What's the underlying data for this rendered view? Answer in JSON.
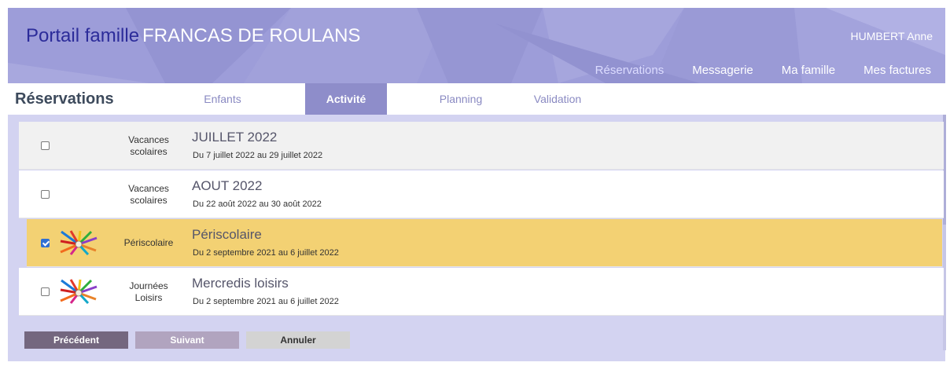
{
  "header": {
    "portal_label": "Portail famille",
    "org_name": "FRANCAS DE ROULANS",
    "user": "HUMBERT Anne",
    "nav": [
      {
        "label": "Réservations"
      },
      {
        "label": "Messagerie"
      },
      {
        "label": "Ma famille"
      },
      {
        "label": "Mes factures"
      }
    ]
  },
  "subheader": {
    "title": "Réservations",
    "tabs": [
      {
        "label": "Enfants"
      },
      {
        "label": "Activité"
      },
      {
        "label": "Planning"
      },
      {
        "label": "Validation"
      }
    ]
  },
  "activities": [
    {
      "checked": false,
      "type": "Vacances scolaires",
      "title": "JUILLET 2022",
      "dates": "Du 7 juillet 2022 au 29 juillet 2022",
      "thumbnail": null
    },
    {
      "checked": false,
      "type": "Vacances scolaires",
      "title": "AOUT 2022",
      "dates": "Du 22 août 2022 au 30 août 2022",
      "thumbnail": null
    },
    {
      "checked": true,
      "type": "Périscolaire",
      "title": "Périscolaire",
      "dates": "Du 2 septembre 2021 au 6 juillet 2022",
      "thumbnail": "colored-pencils-icon"
    },
    {
      "checked": false,
      "type": "Journées Loisirs",
      "title": "Mercredis loisirs",
      "dates": "Du 2 septembre 2021 au 6 juillet 2022",
      "thumbnail": "colored-pencils-icon"
    }
  ],
  "buttons": {
    "prev": "Précédent",
    "next": "Suivant",
    "cancel": "Annuler"
  },
  "colors": {
    "header_bg": "#9c9cd8",
    "panel_bg": "#d3d3f1",
    "selected_row": "#f3d173",
    "active_tab": "#8e8dca"
  }
}
